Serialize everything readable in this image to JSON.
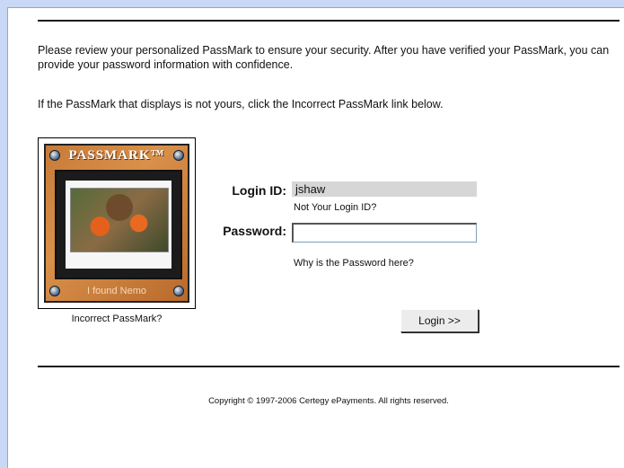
{
  "intro": {
    "line1": "Please review your personalized PassMark to ensure your security. After you have verified your PassMark, you can provide your password information with confidence.",
    "line2": "If the PassMark that displays is not yours, click the Incorrect PassMark link below."
  },
  "passmark": {
    "title": "PASSMARK™",
    "caption": "I found Nemo",
    "incorrect_link": "Incorrect PassMark?"
  },
  "form": {
    "login_id_label": "Login ID:",
    "login_id_value": "jshaw",
    "not_your_id_link": "Not Your Login ID?",
    "password_label": "Password:",
    "password_value": "",
    "why_password_link": "Why is the Password here?",
    "login_button": "Login >>"
  },
  "footer": {
    "copyright": "Copyright © 1997-2006 Certegy ePayments. All rights reserved."
  },
  "colors": {
    "page_background": "#c9d8f5",
    "passmark_board": "#d9904a"
  }
}
